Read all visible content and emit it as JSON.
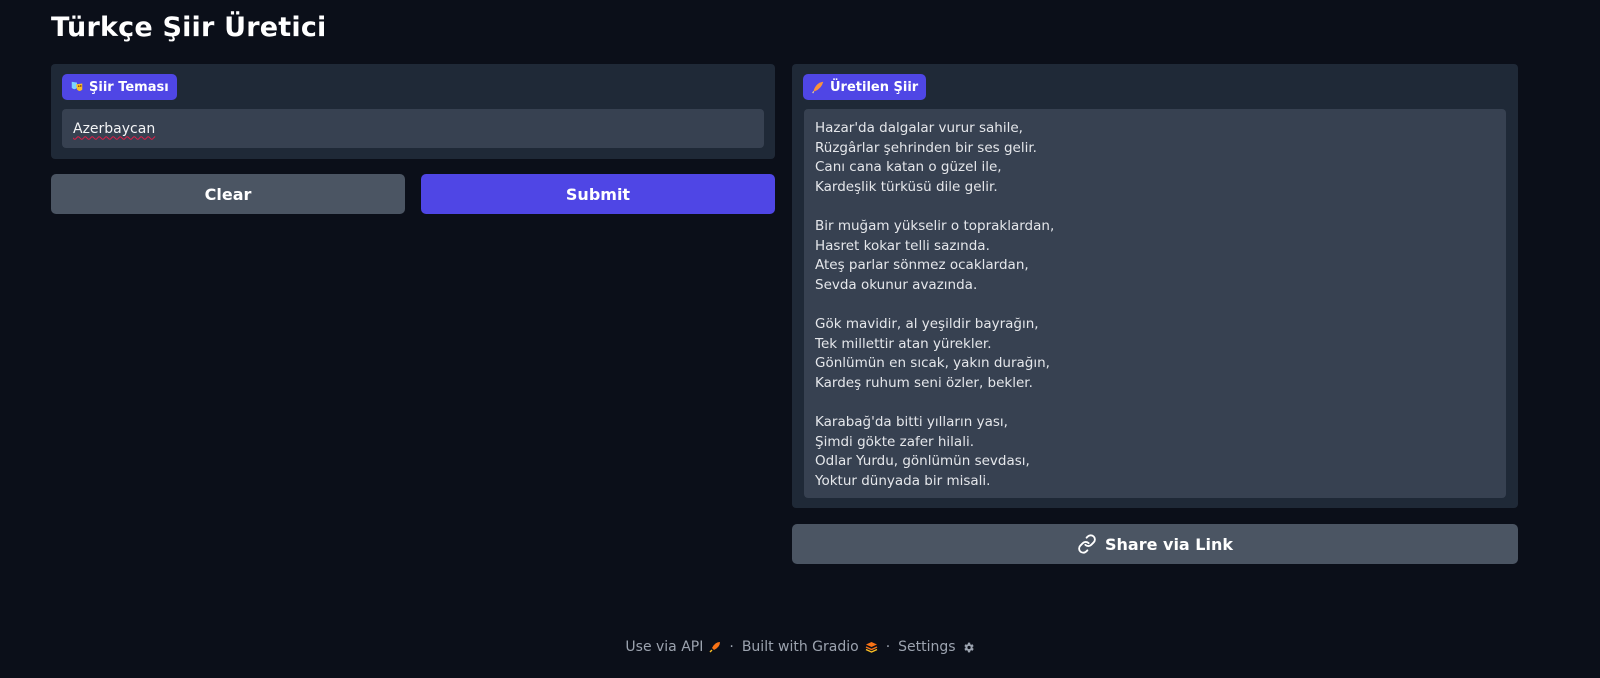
{
  "app": {
    "title": "Türkçe Şiir Üretici"
  },
  "input_panel": {
    "label": "Şiir Teması",
    "label_icon": "theater-masks-icon",
    "value": "Azerbaycan"
  },
  "output_panel": {
    "label": "Üretilen Şiir",
    "label_icon": "quill-feather-icon",
    "stanzas": [
      [
        "Hazar'da dalgalar vurur sahile,",
        "Rüzgârlar şehrinden bir ses gelir.",
        "Canı cana katan o güzel ile,",
        "Kardeşlik türküsü dile gelir."
      ],
      [
        "Bir muğam yükselir o topraklardan,",
        "Hasret kokar telli sazında.",
        "Ateş parlar sönmez ocaklardan,",
        "Sevda okunur avazında."
      ],
      [
        "Gök mavidir, al yeşildir bayrağın,",
        "Tek millettir atan yürekler.",
        "Gönlümün en sıcak, yakın durağın,",
        "Kardeş ruhum seni özler, bekler."
      ],
      [
        "Karabağ'da bitti yılların yası,",
        "Şimdi gökte zafer hilali.",
        "Odlar Yurdu, gönlümün sevdası,",
        "Yoktur dünyada bir misali."
      ]
    ]
  },
  "buttons": {
    "clear": "Clear",
    "submit": "Submit",
    "share": "Share via Link"
  },
  "footer": {
    "api": "Use via API",
    "built": "Built with Gradio",
    "settings": "Settings"
  },
  "colors": {
    "background": "#0b0f19",
    "panel": "#1f2937",
    "input": "#374151",
    "accent": "#4f46e5",
    "secondary_button": "#4b5563"
  }
}
